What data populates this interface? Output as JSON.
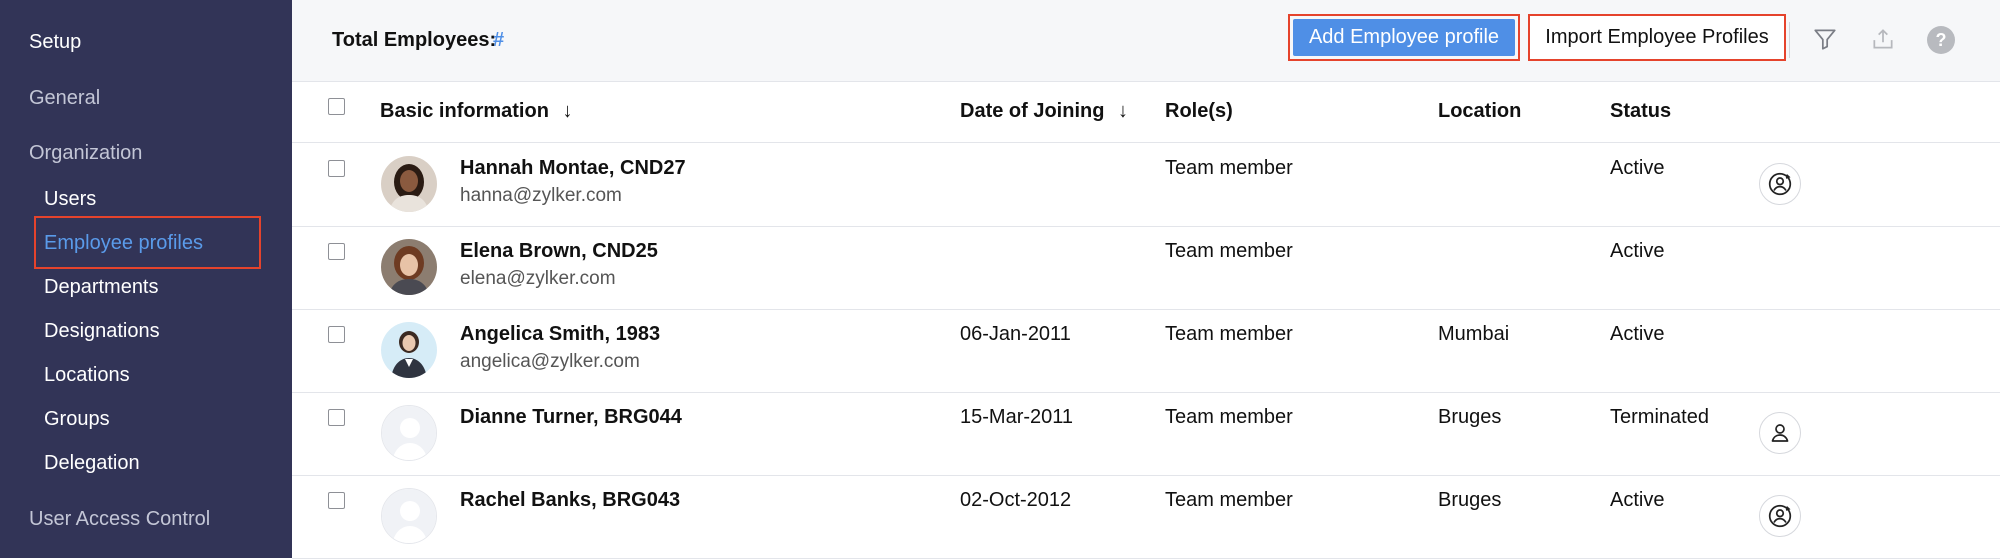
{
  "sidebar": {
    "header": "Setup",
    "general": "General",
    "organization": "Organization",
    "items": [
      "Users",
      "Employee profiles",
      "Departments",
      "Designations",
      "Locations",
      "Groups",
      "Delegation"
    ],
    "user_access": "User Access Control",
    "active_index": 1
  },
  "toolbar": {
    "total_label": "Total Employees:",
    "total_value": "#",
    "add_button": "Add Employee profile",
    "import_button": "Import Employee Profiles",
    "icons": [
      "filter-icon",
      "export-icon",
      "help-icon"
    ]
  },
  "table": {
    "headers": {
      "basic": "Basic information",
      "doj": "Date of Joining",
      "roles": "Role(s)",
      "location": "Location",
      "status": "Status"
    },
    "sort_glyph": "↓",
    "rows": [
      {
        "name": "Hannah Montae, CND27",
        "email": "hanna@zylker.com",
        "doj": "",
        "role": "Team member",
        "location": "",
        "status": "Active",
        "action": "user-reactivate-icon",
        "avatar": "photo"
      },
      {
        "name": "Elena Brown, CND25",
        "email": "elena@zylker.com",
        "doj": "",
        "role": "Team member",
        "location": "",
        "status": "Active",
        "action": "",
        "avatar": "photo"
      },
      {
        "name": "Angelica Smith, 1983",
        "email": "angelica@zylker.com",
        "doj": "06-Jan-2011",
        "role": "Team member",
        "location": "Mumbai",
        "status": "Active",
        "action": "",
        "avatar": "photo"
      },
      {
        "name": "Dianne Turner, BRG044",
        "email": "",
        "doj": "15-Mar-2011",
        "role": "Team member",
        "location": "Bruges",
        "status": "Terminated",
        "action": "user-icon",
        "avatar": "placeholder"
      },
      {
        "name": "Rachel Banks, BRG043",
        "email": "",
        "doj": "02-Oct-2012",
        "role": "Team member",
        "location": "Bruges",
        "status": "Active",
        "action": "user-reactivate-icon",
        "avatar": "placeholder"
      }
    ]
  },
  "colors": {
    "sidebar_bg": "#323457",
    "accent": "#5a9bea",
    "highlight": "#e5432c",
    "primary_button": "#4f8fe6"
  }
}
